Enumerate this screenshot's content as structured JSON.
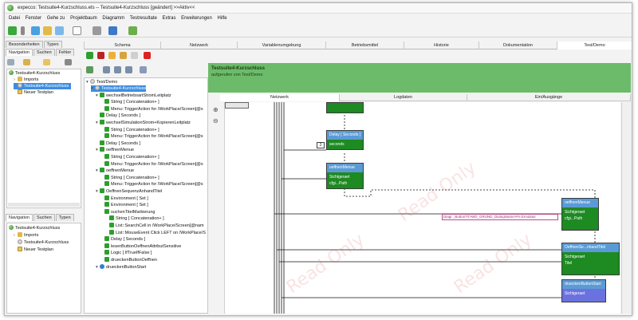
{
  "window": {
    "title": "expecco: Testsuite4-Kurzschluss.ets -- Testsuite4-Kurzschluss [geändert] >>Aktiv<<"
  },
  "menu": [
    "Datei",
    "Fenster",
    "Gehe zu",
    "Projektbaum",
    "Diagramm",
    "Testresultate",
    "Extras",
    "Erweiterungen",
    "Hilfe"
  ],
  "left_tabs_top": [
    "Besonderheiten",
    "Typen"
  ],
  "left_tabs_top2": [
    "Navigation",
    "Suchen",
    "Fehler"
  ],
  "left_tree_top": [
    {
      "label": "Testsuite4-Kurzschluss",
      "icon": "green-ball-icon"
    },
    {
      "label": "Imports",
      "icon": "folder-icon"
    },
    {
      "label": "Testsuite4-Kurzschluss",
      "icon": "gear-icon",
      "selected": true
    },
    {
      "label": "Neuer Testplan",
      "icon": "testplan-icon"
    }
  ],
  "left_tabs_bottom": [
    "Navigation",
    "Suchen",
    "Typen"
  ],
  "left_tree_bottom": [
    {
      "label": "Testsuite4-Kurzschluss",
      "icon": "green-ball-icon"
    },
    {
      "label": "Imports",
      "icon": "folder-icon"
    },
    {
      "label": "Testsuite4-Kurzschluss",
      "icon": "gear-icon"
    },
    {
      "label": "Neuer Testplan",
      "icon": "testplan-icon"
    }
  ],
  "main_tabs": [
    "Schema",
    "Netzwerk",
    "Variablenumgebung",
    "Betriebsmittel",
    "Historie",
    "Dokumentation",
    "Test/Demo"
  ],
  "tree_root": "Test/Demo",
  "tree": [
    {
      "label": "Testsuite4-Kurzschluss",
      "indent": 1,
      "selected": true
    },
    {
      "label": "wechselBetriebsartStromLeitplatz",
      "indent": 2
    },
    {
      "label": "String [ Concatenation+ ]",
      "indent": 3
    },
    {
      "label": "Menu::TriggerAction for /WorkPlace/Screen[@s",
      "indent": 3
    },
    {
      "label": "Delay [ Seconds ]",
      "indent": 2
    },
    {
      "label": "wechselSimulationStrom+KopierenLeitplatz",
      "indent": 2
    },
    {
      "label": "String [ Concatenation+ ]",
      "indent": 3
    },
    {
      "label": "Menu::TriggerAction for /WorkPlace/Screen[@s",
      "indent": 3
    },
    {
      "label": "Delay [ Seconds ]",
      "indent": 2
    },
    {
      "label": "oeffnenMenue",
      "indent": 2
    },
    {
      "label": "String [ Concatenation+ ]",
      "indent": 3
    },
    {
      "label": "Menu::TriggerAction for /WorkPlace/Screen[@s",
      "indent": 3
    },
    {
      "label": "oeffnenMenue",
      "indent": 2
    },
    {
      "label": "String [ Concatenation+ ]",
      "indent": 3
    },
    {
      "label": "Menu::TriggerAction for /WorkPlace/Screen[@s",
      "indent": 3
    },
    {
      "label": "OeffnenSequenzAnhandTitel",
      "indent": 2
    },
    {
      "label": "Environment [ Set ]",
      "indent": 3
    },
    {
      "label": "Environment [ Set ]",
      "indent": 3
    },
    {
      "label": "suchenTitelMarkierung",
      "indent": 3
    },
    {
      "label": "String [ Concatenation+ ]",
      "indent": 4
    },
    {
      "label": "List::SearchCell in /WorkPlace/Screen[@nam",
      "indent": 4
    },
    {
      "label": "List::MouseEvent Click LEFT on /WorkPlace/S",
      "indent": 4
    },
    {
      "label": "Delay [ Seconds ]",
      "indent": 3
    },
    {
      "label": "lesenButtonOeffnenAttributSensitive",
      "indent": 3
    },
    {
      "label": "Logic [ IfTrueIfFalse ]",
      "indent": 3
    },
    {
      "label": "drueckenButtonOeffnen",
      "indent": 3
    },
    {
      "label": "drueckenButtonStart",
      "indent": 2
    }
  ],
  "banner": {
    "title": "Testsuite4-Kurzschluss",
    "subtitle": "aufgerufen von Test/Demo"
  },
  "subtabs": [
    "Netzwerk",
    "Logdaten",
    "Ein/Ausgänge"
  ],
  "nodes": {
    "delay": {
      "header": "Delay [ Seconds ]",
      "body": "seconds",
      "input_value": "2"
    },
    "menu1": {
      "header": "oeffnenMenue",
      "line1": "Sichtgeraet",
      "line2": "cfgi...Path"
    },
    "menu2": {
      "header": "oeffnenMenue",
      "line1": "Sichtgeraet",
      "line2": "cfgi...Path"
    },
    "titel": {
      "header": "OeffnenSe...nhandTitel",
      "line1": "Sichtgeraet",
      "line2": "Titel"
    },
    "start": {
      "header": "drueckenButtonStart",
      "line1": "Sichtgeraet"
    }
  },
  "string_value": "Diagr._ButtonTrl>WD_GRUND_DialogName>Fe.Emulator",
  "watermark": "Read Only",
  "colors": {
    "banner": "#6cbb6a",
    "node_body": "#1e8a22",
    "node_header": "#5b9bd5",
    "selection": "#3d8de0"
  }
}
